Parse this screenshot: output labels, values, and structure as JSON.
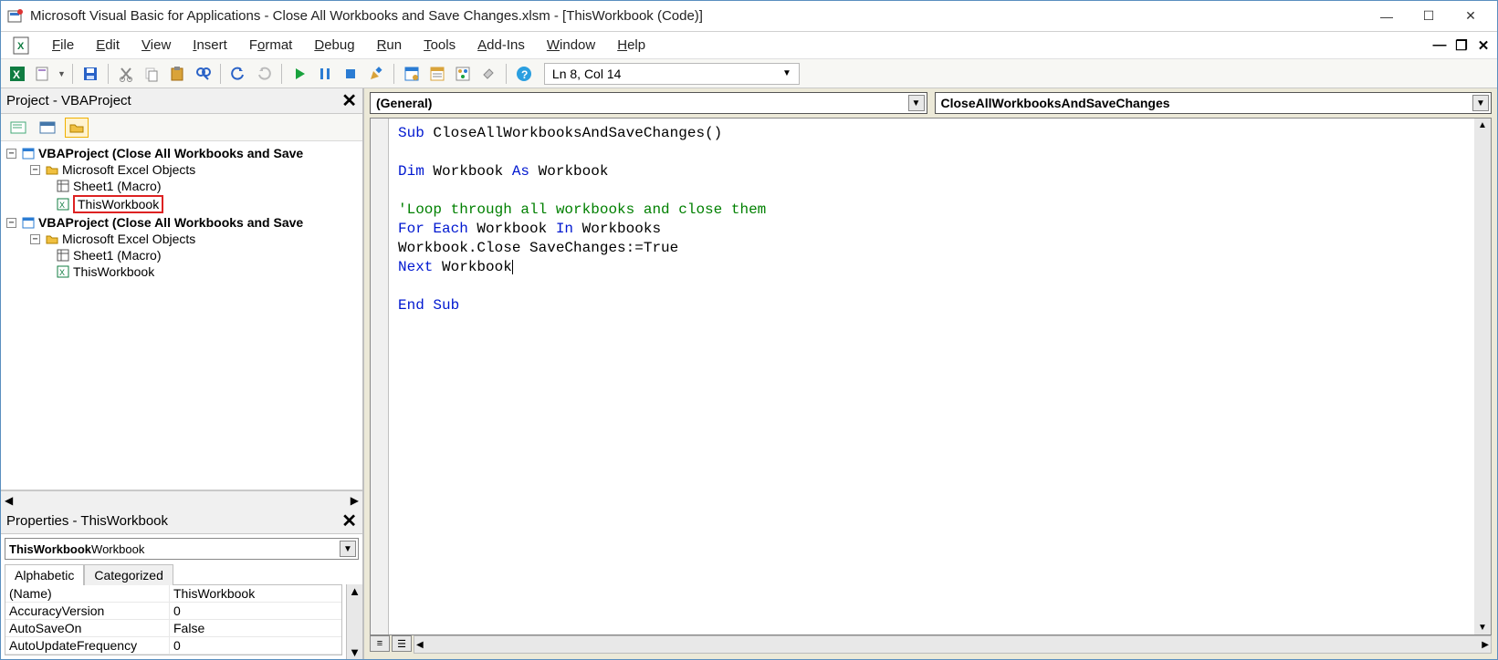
{
  "window": {
    "title": "Microsoft Visual Basic for Applications - Close All Workbooks and Save Changes.xlsm - [ThisWorkbook (Code)]"
  },
  "menu": {
    "file": "File",
    "edit": "Edit",
    "view": "View",
    "insert": "Insert",
    "format": "Format",
    "debug": "Debug",
    "run": "Run",
    "tools": "Tools",
    "addins": "Add-Ins",
    "window": "Window",
    "help": "Help"
  },
  "toolbar": {
    "status": "Ln 8, Col 14"
  },
  "project_pane": {
    "title": "Project - VBAProject",
    "projects": [
      {
        "label": "VBAProject (Close All Workbooks and Save",
        "folder": "Microsoft Excel Objects",
        "items": [
          {
            "label": "Sheet1 (Macro)"
          },
          {
            "label": "ThisWorkbook",
            "selected": true
          }
        ]
      },
      {
        "label": "VBAProject (Close All Workbooks and Save",
        "folder": "Microsoft Excel Objects",
        "items": [
          {
            "label": "Sheet1 (Macro)"
          },
          {
            "label": "ThisWorkbook"
          }
        ]
      }
    ]
  },
  "properties_pane": {
    "title": "Properties - ThisWorkbook",
    "combo_bold": "ThisWorkbook",
    "combo_rest": " Workbook",
    "tabs": {
      "alpha": "Alphabetic",
      "cat": "Categorized"
    },
    "rows": [
      {
        "k": "(Name)",
        "v": "ThisWorkbook"
      },
      {
        "k": "AccuracyVersion",
        "v": "0"
      },
      {
        "k": "AutoSaveOn",
        "v": "False"
      },
      {
        "k": "AutoUpdateFrequency",
        "v": "0"
      }
    ]
  },
  "code_combos": {
    "left": "(General)",
    "right": "CloseAllWorkbooksAndSaveChanges"
  },
  "code": {
    "l1a": "Sub",
    "l1b": " CloseAllWorkbooksAndSaveChanges()",
    "l3a": "Dim",
    "l3b": " Workbook ",
    "l3c": "As",
    "l3d": " Workbook",
    "l5": "'Loop through all workbooks and close them",
    "l6a": "For Each",
    "l6b": " Workbook ",
    "l6c": "In",
    "l6d": " Workbooks",
    "l7": "Workbook.Close SaveChanges:=True",
    "l8a": "Next",
    "l8b": " Workbook",
    "l10": "End Sub"
  }
}
